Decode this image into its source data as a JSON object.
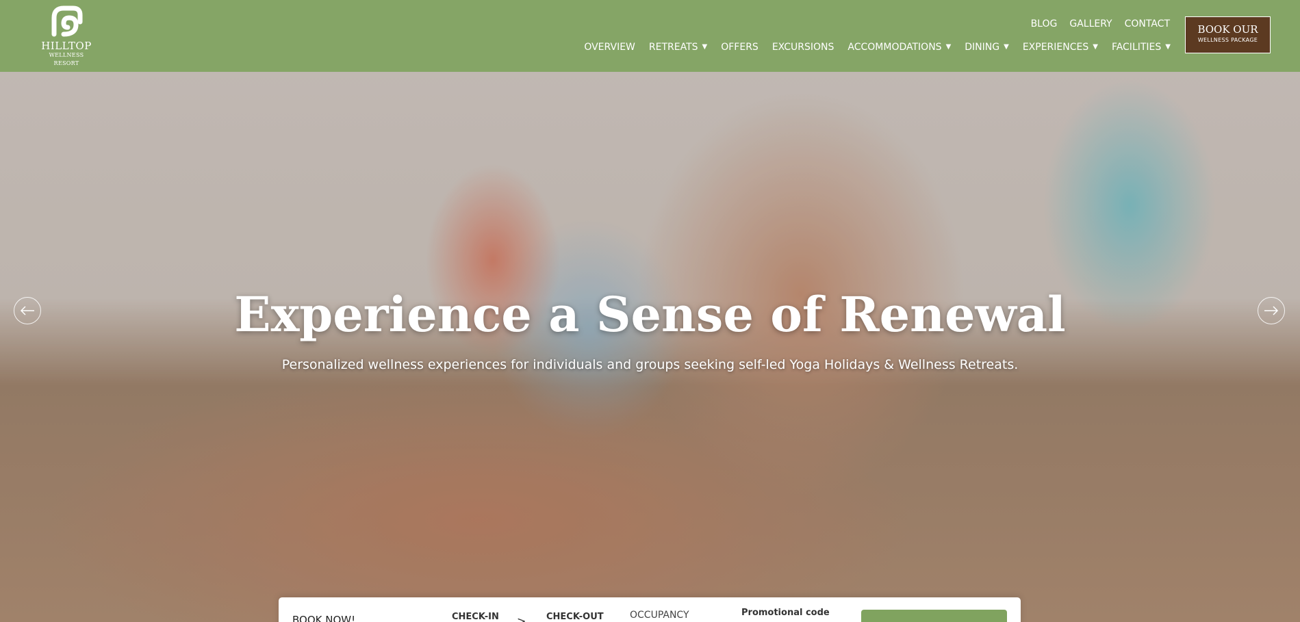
{
  "brand": {
    "name": "HILLTOP",
    "tagline": "WELLNESS RESORT"
  },
  "utility_nav": [
    "BLOG",
    "GALLERY",
    "CONTACT"
  ],
  "main_nav": [
    {
      "label": "OVERVIEW",
      "has_dropdown": false
    },
    {
      "label": "RETREATS",
      "has_dropdown": true
    },
    {
      "label": "OFFERS",
      "has_dropdown": false
    },
    {
      "label": "EXCURSIONS",
      "has_dropdown": false
    },
    {
      "label": "ACCOMMODATIONS",
      "has_dropdown": true
    },
    {
      "label": "DINING",
      "has_dropdown": true
    },
    {
      "label": "EXPERIENCES",
      "has_dropdown": true
    },
    {
      "label": "FACILITIES",
      "has_dropdown": true
    }
  ],
  "book_button": {
    "line1": "BOOK OUR",
    "line2": "WELLNESS PACKAGE"
  },
  "hero": {
    "title": "Experience a Sense of Renewal",
    "subtitle": "Personalized wellness experiences for individuals and groups seeking self-led Yoga Holidays & Wellness Retreats."
  },
  "booking": {
    "title": "BOOK NOW!",
    "check_in": "CHECK-IN",
    "separator": ">",
    "check_out": "CHECK-OUT",
    "occupancy": "OCCUPANCY",
    "promo": "Promotional code"
  },
  "colors": {
    "header_green": "#80a35f",
    "book_brown": "#5c3a21",
    "text_white": "#ffffff"
  },
  "icons": {
    "logo": "hilltop-logo-icon",
    "dropdown": "caret-down-icon",
    "prev": "arrow-left-icon",
    "next": "arrow-right-icon"
  }
}
